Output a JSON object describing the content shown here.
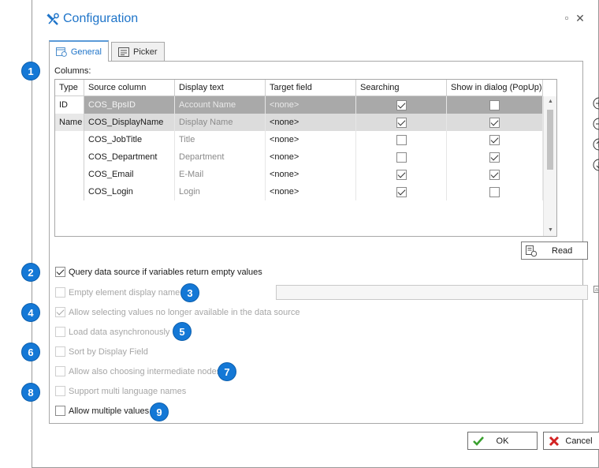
{
  "window": {
    "title": "Configuration",
    "minimize_icon": "restore-icon",
    "close_icon": "close-icon"
  },
  "tabs": [
    {
      "label": "General",
      "active": true
    },
    {
      "label": "Picker",
      "active": false
    }
  ],
  "columns_label": "Columns:",
  "grid": {
    "headers": [
      "Type",
      "Source column",
      "Display text",
      "Target field",
      "Searching",
      "Show in dialog (PopUp)"
    ],
    "rows": [
      {
        "type": "ID",
        "source": "COS_BpsID",
        "display": "Account Name",
        "target": "<none>",
        "searching": true,
        "show": false
      },
      {
        "type": "Name",
        "source": "COS_DisplayName",
        "display": "Display Name",
        "target": "<none>",
        "searching": true,
        "show": true
      },
      {
        "type": "",
        "source": "COS_JobTitle",
        "display": "Title",
        "target": "<none>",
        "searching": false,
        "show": true
      },
      {
        "type": "",
        "source": "COS_Department",
        "display": "Department",
        "target": "<none>",
        "searching": false,
        "show": true
      },
      {
        "type": "",
        "source": "COS_Email",
        "display": "E-Mail",
        "target": "<none>",
        "searching": true,
        "show": true
      },
      {
        "type": "",
        "source": "COS_Login",
        "display": "Login",
        "target": "<none>",
        "searching": true,
        "show": false
      }
    ]
  },
  "side_buttons": [
    "add-icon",
    "remove-icon",
    "move-up-icon",
    "move-down-icon"
  ],
  "read_button": "Read",
  "options": [
    {
      "label": "Query data source if variables return empty values",
      "checked": true,
      "enabled": true
    },
    {
      "label": "Empty element display name",
      "checked": false,
      "enabled": false
    },
    {
      "label": "Allow selecting values no longer available in the data source",
      "checked": true,
      "enabled": false
    },
    {
      "label": "Load data asynchronously",
      "checked": false,
      "enabled": false
    },
    {
      "label": "Sort by Display Field",
      "checked": false,
      "enabled": false
    },
    {
      "label": "Allow also choosing intermediate nodes",
      "checked": false,
      "enabled": false
    },
    {
      "label": "Support multi language names",
      "checked": false,
      "enabled": false
    },
    {
      "label": "Allow multiple values",
      "checked": false,
      "enabled": true
    }
  ],
  "empty_name_value": "",
  "badges": [
    "1",
    "2",
    "3",
    "4",
    "5",
    "6",
    "7",
    "8",
    "9"
  ],
  "buttons": {
    "ok": "OK",
    "cancel": "Cancel"
  },
  "colors": {
    "title": "#1e74c9",
    "badge": "#1478d6",
    "ok_check": "#3aa02f",
    "cancel_x": "#d32222"
  }
}
